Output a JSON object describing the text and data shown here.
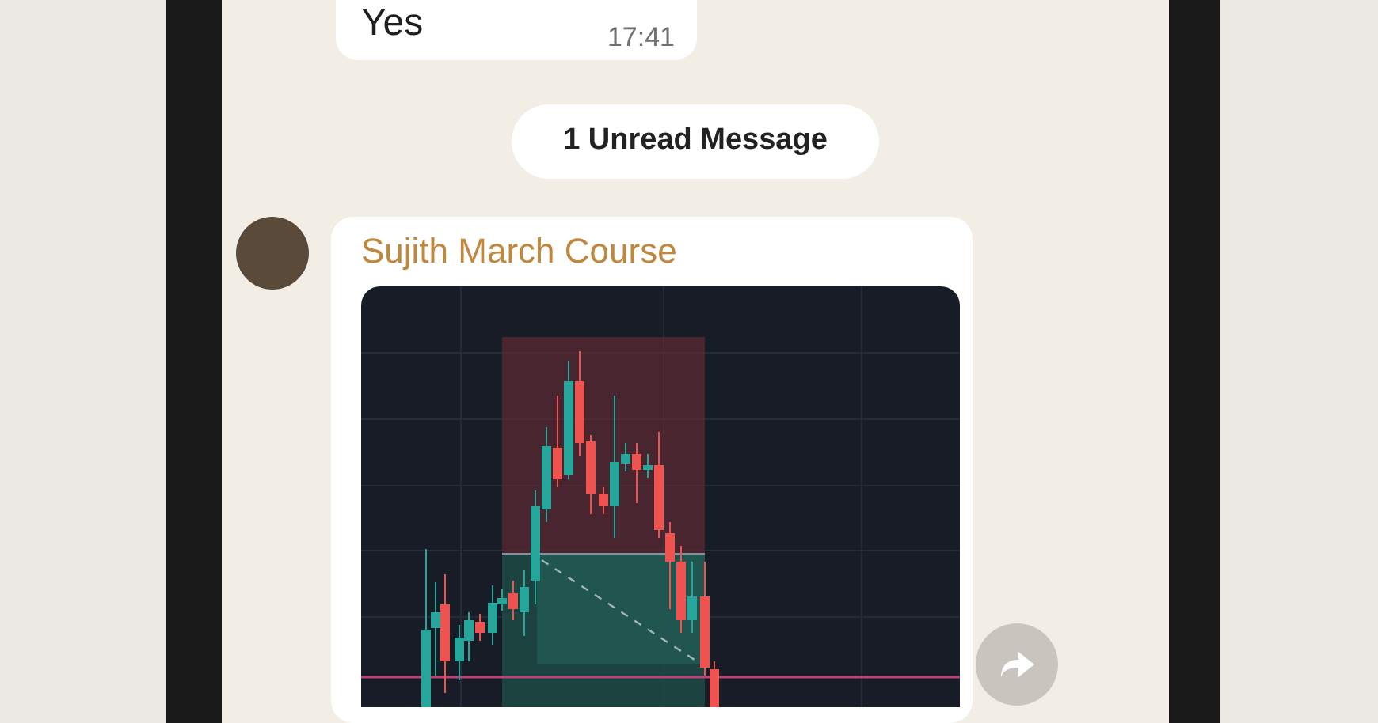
{
  "messages_above": [
    {
      "text": "Yes",
      "time": "17:41"
    }
  ],
  "unread_divider": {
    "label": "1 Unread Message"
  },
  "message": {
    "sender": "Sujith March Course"
  }
}
